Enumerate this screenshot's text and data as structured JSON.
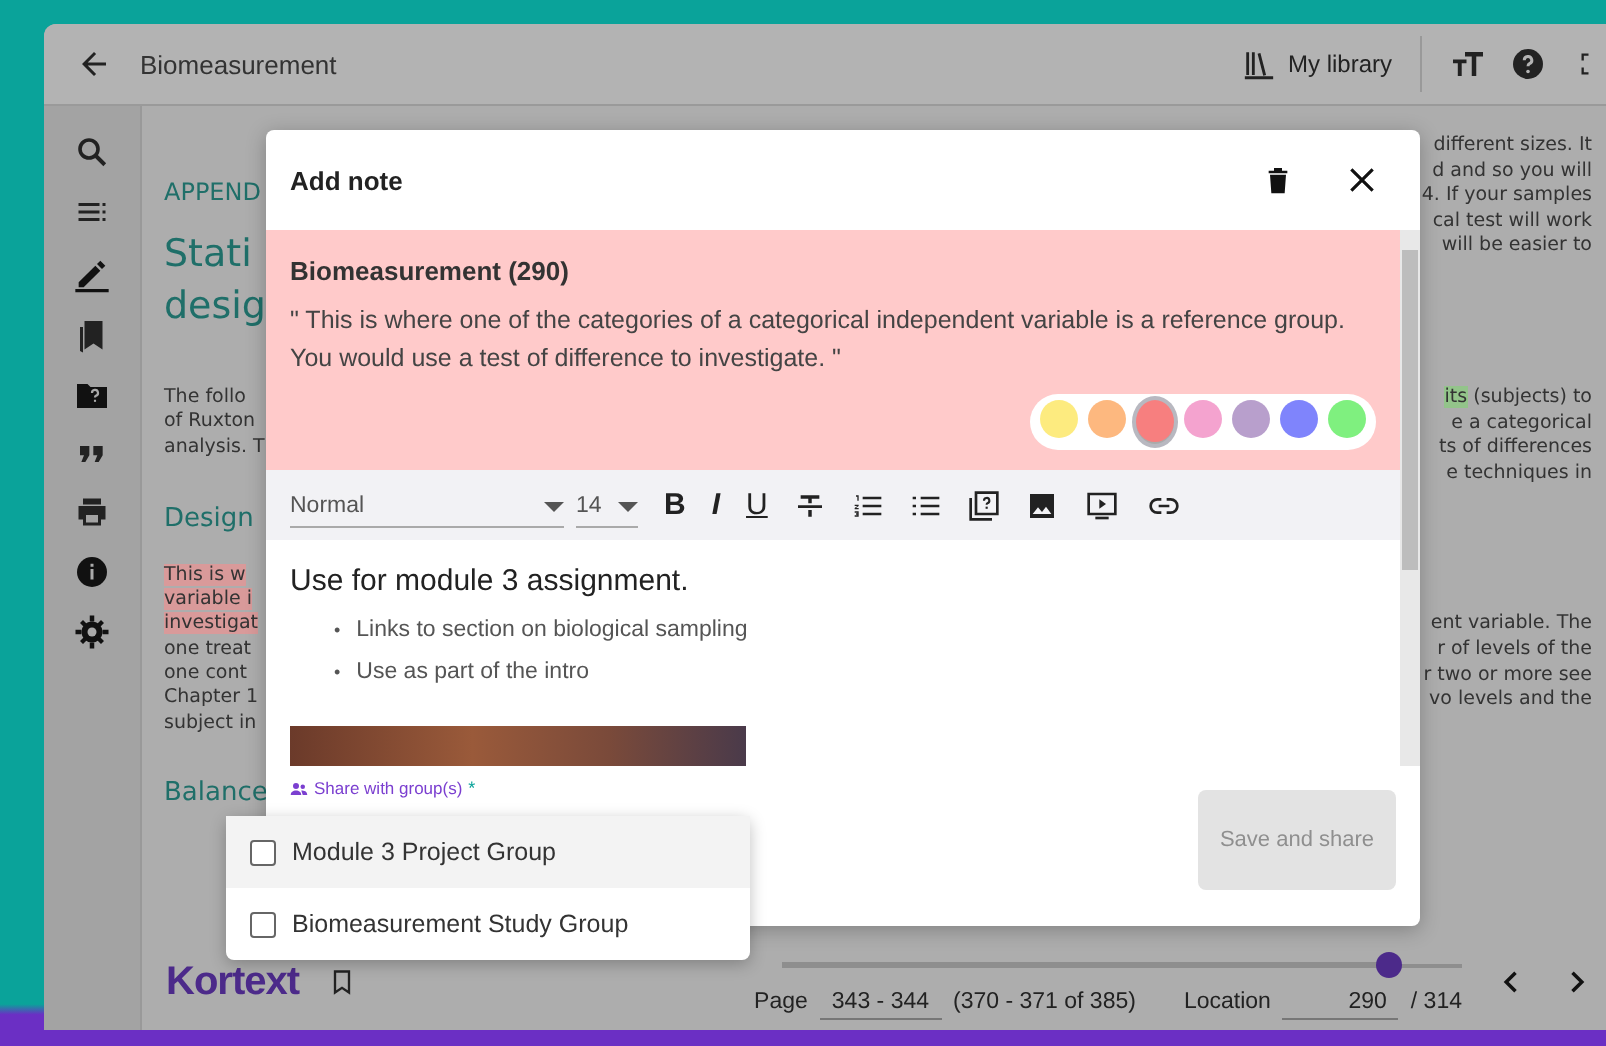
{
  "header": {
    "title": "Biomeasurement",
    "library_label": "My library"
  },
  "background": {
    "left": [
      {
        "kind": "section",
        "spans": [
          {
            "text": "APPEND"
          }
        ]
      },
      {
        "kind": "title",
        "spans": [
          {
            "text": "Stati"
          }
        ]
      },
      {
        "kind": "title",
        "spans": [
          {
            "text": "desig"
          }
        ]
      },
      {
        "kind": "para",
        "spans": [
          {
            "text": "The follo"
          }
        ]
      },
      {
        "kind": "body",
        "spans": [
          {
            "text": "of Ruxton"
          }
        ]
      },
      {
        "kind": "body",
        "spans": [
          {
            "text": "analysis. T"
          }
        ]
      },
      {
        "kind": "heading",
        "spans": [
          {
            "text": "Design"
          }
        ]
      },
      {
        "kind": "body",
        "spans": [
          {
            "text": "This is w",
            "color": "#d99a9a"
          }
        ]
      },
      {
        "kind": "body",
        "spans": [
          {
            "text": "variable i",
            "color": "#d99a9a"
          }
        ]
      },
      {
        "kind": "body",
        "spans": [
          {
            "text": "investigat",
            "color": "#d99a9a"
          }
        ]
      },
      {
        "kind": "body",
        "spans": [
          {
            "text": "one treat"
          }
        ]
      },
      {
        "kind": "body",
        "spans": [
          {
            "text": "one cont"
          }
        ]
      },
      {
        "kind": "body",
        "spans": [
          {
            "text": "Chapter 1"
          }
        ]
      },
      {
        "kind": "body",
        "spans": [
          {
            "text": "subject in"
          }
        ]
      },
      {
        "kind": "heading",
        "spans": [
          {
            "text": "Balance"
          }
        ]
      }
    ],
    "right": [
      {
        "kind": "body",
        "spans": [
          {
            "text": "different sizes. It"
          }
        ]
      },
      {
        "kind": "body",
        "spans": [
          {
            "text": "d and so you will"
          }
        ]
      },
      {
        "kind": "body",
        "spans": [
          {
            "text": "4. If your samples"
          }
        ]
      },
      {
        "kind": "body",
        "spans": [
          {
            "text": "cal test will work"
          }
        ]
      },
      {
        "kind": "body",
        "spans": [
          {
            "text": "will be easier to"
          }
        ]
      },
      {
        "kind": "para",
        "spans": [
          {
            "text": "its",
            "color": "#93c48a"
          },
          {
            "text": " (subjects) to"
          }
        ]
      },
      {
        "kind": "body",
        "spans": [
          {
            "text": "e a categorical"
          }
        ]
      },
      {
        "kind": "body",
        "spans": [
          {
            "text": "ts of differences"
          }
        ]
      },
      {
        "kind": "body",
        "spans": [
          {
            "text": "e techniques in"
          }
        ]
      },
      {
        "kind": "para",
        "spans": [
          {
            "text": "ent variable. The"
          }
        ]
      },
      {
        "kind": "body",
        "spans": [
          {
            "text": "r of levels of the"
          }
        ]
      },
      {
        "kind": "body",
        "spans": [
          {
            "text": "r two or more see"
          }
        ]
      },
      {
        "kind": "body",
        "spans": [
          {
            "text": "vo levels and the"
          }
        ]
      }
    ]
  },
  "modal": {
    "title": "Add note",
    "source": {
      "title": "Biomeasurement (290)",
      "quote": "\" This is where one of the categories of a categorical independent variable is a reference group. You would use a test of difference to investigate. \""
    },
    "colors": [
      {
        "color": "#fdeb7f",
        "selected": false
      },
      {
        "color": "#fdb87f",
        "selected": false
      },
      {
        "color": "#f77f7f",
        "selected": true
      },
      {
        "color": "#f4a3cf",
        "selected": false
      },
      {
        "color": "#b89fcc",
        "selected": false
      },
      {
        "color": "#7f84fc",
        "selected": false
      },
      {
        "color": "#7ff07f",
        "selected": false
      }
    ],
    "toolbar": {
      "style": "Normal",
      "size": "14",
      "buttons": [
        {
          "kind": "bold",
          "label": "B"
        },
        {
          "kind": "italic",
          "label": "I"
        },
        {
          "kind": "underline",
          "label": "U"
        },
        {
          "kind": "strike"
        },
        {
          "kind": "ordered"
        },
        {
          "kind": "bullets"
        },
        {
          "kind": "help"
        },
        {
          "kind": "image"
        },
        {
          "kind": "video"
        },
        {
          "kind": "link"
        }
      ]
    },
    "note": {
      "heading": "Use for module 3 assignment.",
      "bullets": [
        {
          "marker": "•",
          "text": "Links to section on biological sampling"
        },
        {
          "marker": "•",
          "text": "Use as part of the intro"
        }
      ]
    },
    "share_label": "Share with group(s)",
    "required_mark": "*",
    "save_button": {
      "label": "Save and share",
      "disabled": true
    }
  },
  "groups": [
    {
      "label": "Module 3 Project Group",
      "checked": false,
      "highlighted": true
    },
    {
      "label": "Biomeasurement Study Group",
      "checked": false,
      "highlighted": false
    }
  ],
  "footer": {
    "logo": "Kortext",
    "level": 0.89,
    "page_label": "Page",
    "page_value": "343 - 344",
    "page_total": "(370 - 371 of 385)",
    "location_label": "Location",
    "location_value": "290",
    "location_total": "/ 314"
  }
}
